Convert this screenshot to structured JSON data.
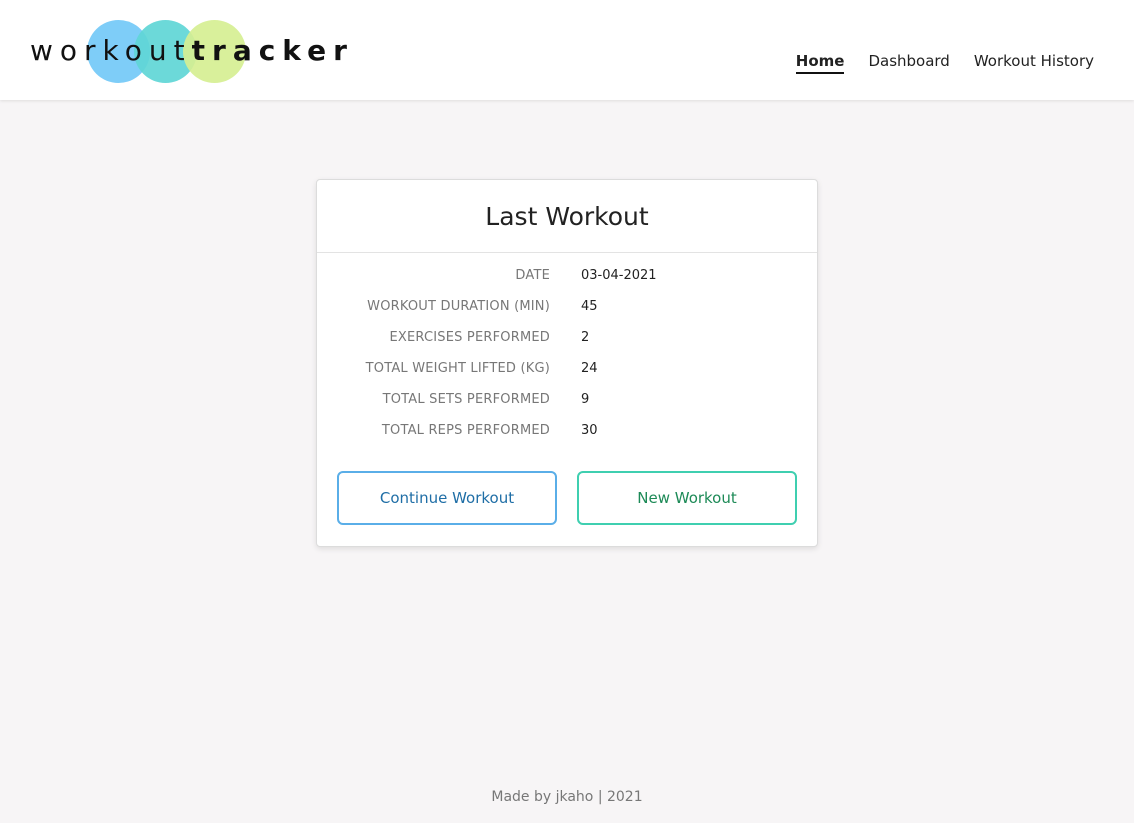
{
  "header": {
    "logo": {
      "text_light": "workout",
      "text_bold": "tracker"
    },
    "nav": [
      {
        "label": "Home",
        "active": true
      },
      {
        "label": "Dashboard",
        "active": false
      },
      {
        "label": "Workout History",
        "active": false
      }
    ]
  },
  "card": {
    "title": "Last Workout",
    "stats": [
      {
        "label": "DATE",
        "value": "03-04-2021"
      },
      {
        "label": "WORKOUT DURATION (MIN)",
        "value": "45"
      },
      {
        "label": "EXERCISES PERFORMED",
        "value": "2"
      },
      {
        "label": "TOTAL WEIGHT LIFTED (KG)",
        "value": "24"
      },
      {
        "label": "TOTAL SETS PERFORMED",
        "value": "9"
      },
      {
        "label": "TOTAL REPS PERFORMED",
        "value": "30"
      }
    ],
    "buttons": {
      "continue_label": "Continue Workout",
      "new_label": "New Workout"
    }
  },
  "footer": {
    "text": "Made by jkaho | 2021"
  },
  "colors": {
    "page_background": "#f7f5f6",
    "continue_border": "#5aaee8",
    "continue_text": "#1f6ea6",
    "new_border": "#3fcfb0",
    "new_text": "#1d8a57",
    "logo_circle_blue": "#7ecdf8",
    "logo_circle_teal": "#5fd6d6",
    "logo_circle_lime": "#d6ef93"
  }
}
